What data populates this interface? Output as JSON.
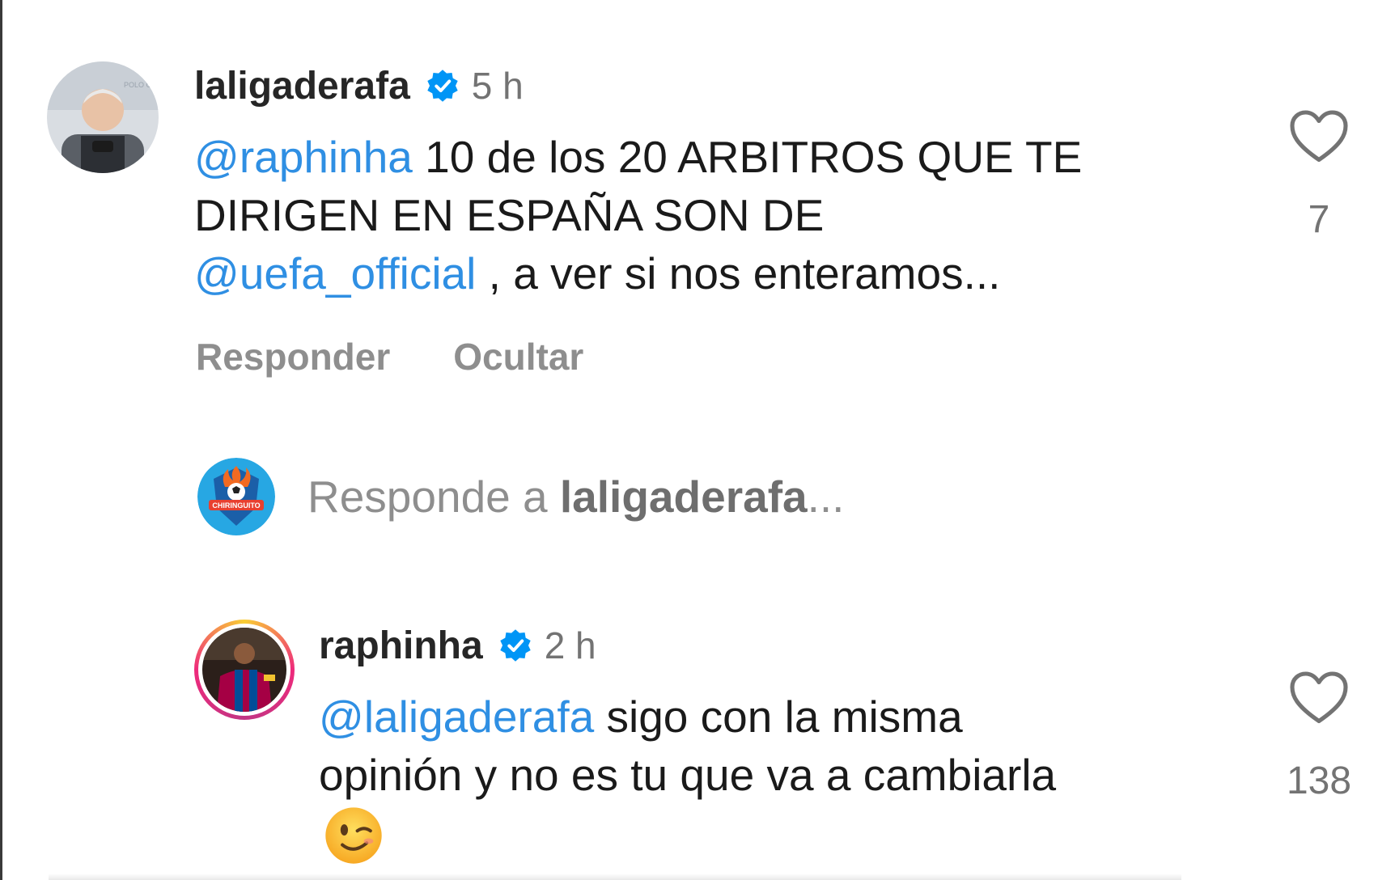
{
  "comments": [
    {
      "username": "laligaderafa",
      "time": "5 h",
      "mention": "@raphinha",
      "text_line1": " 10 de los 20 ARBITROS QUE TE",
      "text_line2": "DIRIGEN EN ESPAÑA SON DE",
      "mention2": "@uefa_official",
      "text_line3": " , a ver si nos enteramos...",
      "likes": "7",
      "reply_label": "Responder",
      "hide_label": "Ocultar"
    },
    {
      "username": "raphinha",
      "time": "2 h",
      "mention": "@laligaderafa",
      "text_line1": " sigo con la misma",
      "text_line2": "opinión y no es tu que va a cambiarla",
      "likes": "138"
    }
  ],
  "reply_input": {
    "prefix": "Responde a ",
    "target": "laligaderafa",
    "suffix": "..."
  },
  "icons": {
    "verified": "verified-badge-icon",
    "like": "heart-icon",
    "emoji": "winking-face-emoji"
  },
  "colors": {
    "mention": "#2f8fe3",
    "verified": "#0095f6",
    "secondary_text": "#8e8e8e"
  }
}
